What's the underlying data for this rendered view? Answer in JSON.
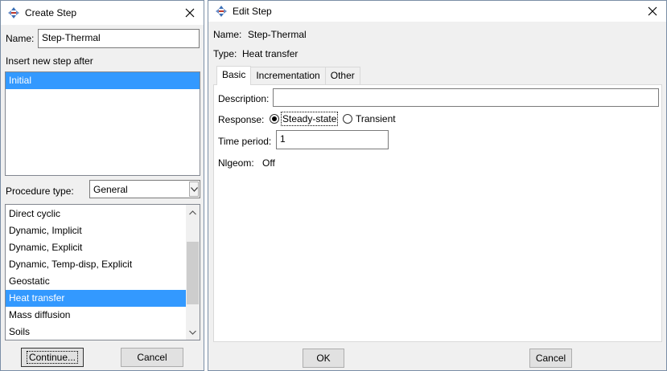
{
  "create_step": {
    "title": "Create Step",
    "name_label": "Name:",
    "name_value": "Step-Thermal",
    "insert_label": "Insert new step after",
    "insert_items": [
      "Initial"
    ],
    "procedure_label": "Procedure type:",
    "procedure_value": "General",
    "procedure_items": [
      "Direct cyclic",
      "Dynamic, Implicit",
      "Dynamic, Explicit",
      "Dynamic, Temp-disp, Explicit",
      "Geostatic",
      "Heat transfer",
      "Mass diffusion",
      "Soils"
    ],
    "continue_label": "Continue...",
    "cancel_label": "Cancel"
  },
  "edit_step": {
    "title": "Edit Step",
    "name_label": "Name:",
    "name_value": "Step-Thermal",
    "type_label": "Type:",
    "type_value": "Heat transfer",
    "tabs": [
      "Basic",
      "Incrementation",
      "Other"
    ],
    "description_label": "Description:",
    "description_value": "",
    "response_label": "Response:",
    "response_options": [
      "Steady-state",
      "Transient"
    ],
    "time_period_label": "Time period:",
    "time_period_value": "1",
    "nlgeom_label": "Nlgeom:",
    "nlgeom_value": "Off",
    "ok_label": "OK",
    "cancel_label": "Cancel"
  },
  "colors": {
    "selection": "#3399ff",
    "window_bg": "#f0f0f0",
    "border": "#7a8ea6"
  },
  "icons": {
    "app": "abaqus-step-icon",
    "close": "close-icon",
    "combo": "chevron-down-icon",
    "scroll_up": "scroll-up-arrow",
    "scroll_down": "scroll-down-arrow"
  }
}
